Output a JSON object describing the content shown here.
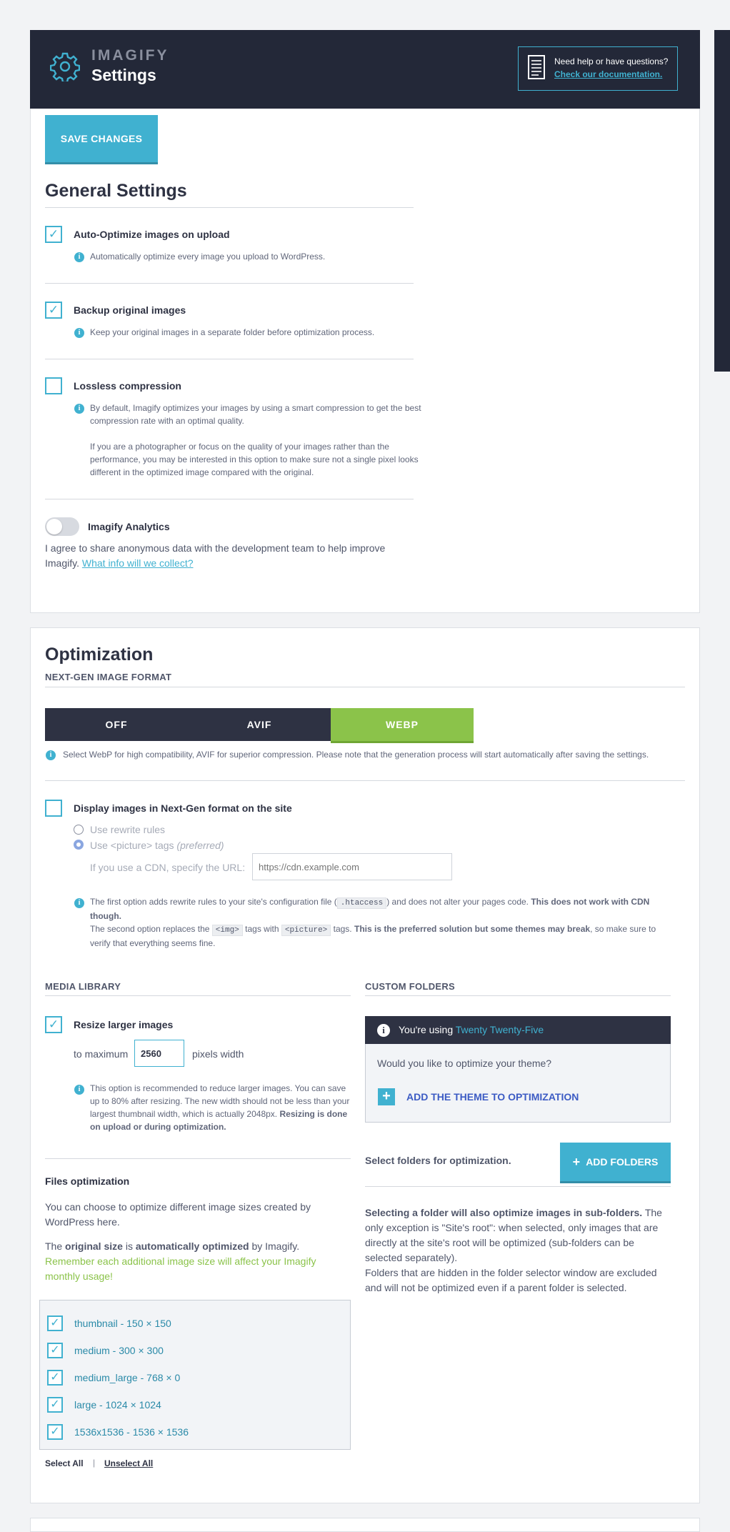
{
  "header": {
    "brand": "IMAGIFY",
    "title": "Settings",
    "help_line1": "Need help or have questions?",
    "help_line2": "Check our documentation.",
    "bg_color": "#232838",
    "accent_color": "#40b1d0"
  },
  "save_button": "SAVE CHANGES",
  "general": {
    "title": "General Settings",
    "auto_optimize": {
      "label": "Auto-Optimize images on upload",
      "checked": true,
      "help": "Automatically optimize every image you upload to WordPress."
    },
    "backup": {
      "label": "Backup original images",
      "checked": true,
      "help": "Keep your original images in a separate folder before optimization process."
    },
    "lossless": {
      "label": "Lossless compression",
      "checked": false,
      "help1": "By default, Imagify optimizes your images by using a smart compression to get the best compression rate with an optimal quality.",
      "help2": "If you are a photographer or focus on the quality of your images rather than the performance, you may be interested in this option to make sure not a single pixel looks different in the optimized image compared with the original."
    },
    "analytics": {
      "label": "Imagify Analytics",
      "enabled": false,
      "text": "I agree to share anonymous data with the development team to help improve Imagify.",
      "link": "What info will we collect?"
    }
  },
  "optimization": {
    "title": "Optimization",
    "nextgen_heading": "NEXT-GEN IMAGE FORMAT",
    "formats": [
      "OFF",
      "AVIF",
      "WEBP"
    ],
    "selected_format": "WEBP",
    "format_help": "Select WebP for high compatibility, AVIF for superior compression. Please note that the generation process will start automatically after saving the settings.",
    "display_nextgen": {
      "label": "Display images in Next-Gen format on the site",
      "checked": false
    },
    "radio_rewrite": "Use rewrite rules",
    "radio_picture": "Use <picture> tags",
    "radio_picture_note": "(preferred)",
    "cdn_label": "If you use a CDN, specify the URL:",
    "cdn_placeholder": "https://cdn.example.com",
    "note1_a": "The first option adds rewrite rules to your site's configuration file (",
    "note1_code": ".htaccess",
    "note1_b": ") and does not alter your pages code.",
    "note1_bold": "This does not work with CDN though.",
    "note2_a": "The second option replaces the",
    "note2_code1": "<img>",
    "note2_b": "tags with",
    "note2_code2": "<picture>",
    "note2_c": "tags.",
    "note2_bold": "This is the preferred solution but some themes may break",
    "note2_d": ", so make sure to verify that everything seems fine."
  },
  "media_library": {
    "heading": "MEDIA LIBRARY",
    "resize": {
      "label": "Resize larger images",
      "checked": true
    },
    "to_maximum": "to maximum",
    "max_width": "2560",
    "pixels_width": "pixels width",
    "resize_help": "This option is recommended to reduce larger images. You can save up to 80% after resizing. The new width should not be less than your largest thumbnail width, which is actually 2048px.",
    "resize_help_bold": "Resizing is done on upload or during optimization.",
    "files_heading": "Files optimization",
    "files_text": "You can choose to optimize different image sizes created by WordPress here.",
    "orig_a": "The",
    "orig_b": "original size",
    "orig_c": "is",
    "orig_d": "automatically optimized",
    "orig_e": "by Imagify.",
    "warning": "Remember each additional image size will affect your Imagify monthly usage!",
    "sizes": [
      {
        "label": "thumbnail - 150 × 150",
        "checked": true
      },
      {
        "label": "medium - 300 × 300",
        "checked": true
      },
      {
        "label": "medium_large - 768 × 0",
        "checked": true
      },
      {
        "label": "large - 1024 × 1024",
        "checked": true
      },
      {
        "label": "1536x1536 - 1536 × 1536",
        "checked": true
      }
    ],
    "select_all": "Select All",
    "separator": "|",
    "unselect_all": "Unselect All"
  },
  "custom_folders": {
    "heading": "CUSTOM FOLDERS",
    "using": "You're using",
    "theme": "Twenty Twenty-Five",
    "question": "Would you like to optimize your theme?",
    "add_theme": "ADD THE THEME TO OPTIMIZATION",
    "select_text": "Select folders for optimization.",
    "add_folders": "ADD FOLDERS",
    "sub_bold": "Selecting a folder will also optimize images in sub-folders.",
    "sub_text": "The only exception is \"Site's root\": when selected, only images that are directly at the site's root will be optimized (sub-folders can be selected separately).",
    "hidden_text": "Folders that are hidden in the folder selector window are excluded and will not be optimized even if a parent folder is selected."
  }
}
